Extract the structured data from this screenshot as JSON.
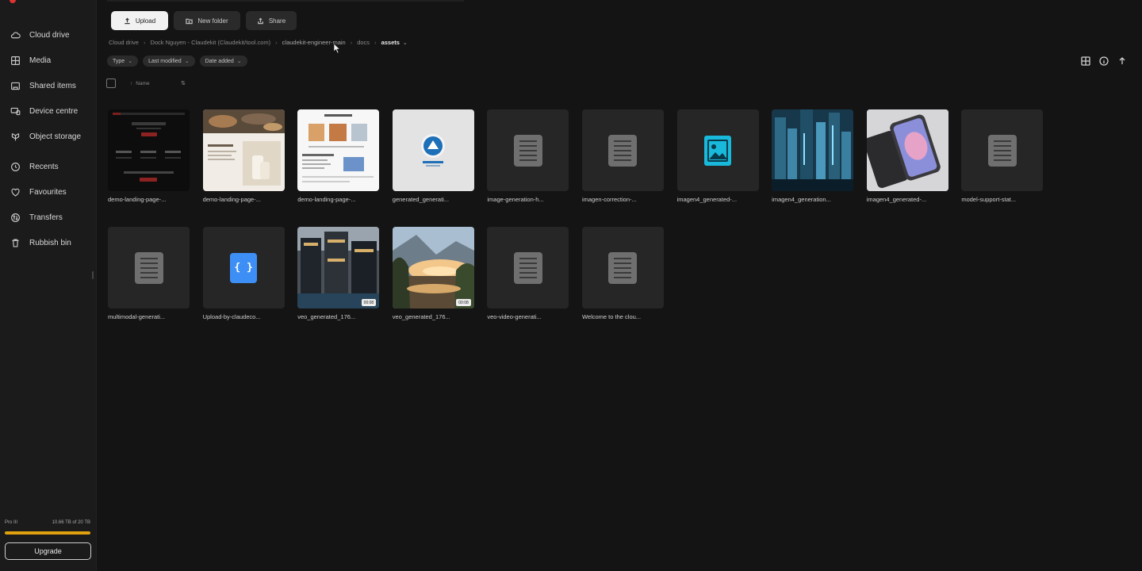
{
  "sidebar": {
    "items": [
      {
        "label": "Cloud drive",
        "icon": "cloud-icon"
      },
      {
        "label": "Media",
        "icon": "media-icon"
      },
      {
        "label": "Shared items",
        "icon": "shared-icon"
      },
      {
        "label": "Device centre",
        "icon": "device-icon"
      },
      {
        "label": "Object storage",
        "icon": "object-storage-icon"
      },
      {
        "label": "Recents",
        "icon": "clock-icon"
      },
      {
        "label": "Favourites",
        "icon": "heart-icon"
      },
      {
        "label": "Transfers",
        "icon": "transfers-icon"
      },
      {
        "label": "Rubbish bin",
        "icon": "trash-icon"
      }
    ],
    "storage_plan": "Pro III",
    "storage_used": "10.66 TB of 20 TB",
    "storage_fraction": 1.0,
    "upgrade_label": "Upgrade"
  },
  "toolbar": {
    "upload_label": "Upload",
    "new_folder_label": "New folder",
    "share_label": "Share"
  },
  "breadcrumb": [
    "Cloud drive",
    "Dock Nguyen - Claudekit (Claudekit/tool.com)",
    "claudekit-engineer-main",
    "docs",
    "assets"
  ],
  "filters": {
    "type": "Type",
    "last_modified": "Last modified",
    "date_added": "Date added"
  },
  "sort": {
    "label": "Name"
  },
  "files": [
    {
      "name": "demo-landing-page-...",
      "kind": "thumb-dark-landing"
    },
    {
      "name": "demo-landing-page-...",
      "kind": "thumb-beige-landing"
    },
    {
      "name": "demo-landing-page-...",
      "kind": "thumb-white-landing"
    },
    {
      "name": "generated_generati...",
      "kind": "thumb-logo"
    },
    {
      "name": "image-generation-h...",
      "kind": "doc"
    },
    {
      "name": "imagen-correction-...",
      "kind": "doc"
    },
    {
      "name": "imagen4_generated-...",
      "kind": "image"
    },
    {
      "name": "imagen4_generation...",
      "kind": "thumb-city"
    },
    {
      "name": "imagen4_generated-...",
      "kind": "thumb-phone"
    },
    {
      "name": "model-support-stat...",
      "kind": "doc"
    },
    {
      "name": "multimodal-generati...",
      "kind": "doc"
    },
    {
      "name": "Upload-by-claudeco...",
      "kind": "code"
    },
    {
      "name": "veo_generated_176...",
      "kind": "thumb-video-city",
      "badge": "00:08"
    },
    {
      "name": "veo_generated_176...",
      "kind": "thumb-video-lake",
      "badge": "00:08"
    },
    {
      "name": "veo-video-generati...",
      "kind": "doc"
    },
    {
      "name": "Welcome to the clou...",
      "kind": "doc"
    }
  ]
}
